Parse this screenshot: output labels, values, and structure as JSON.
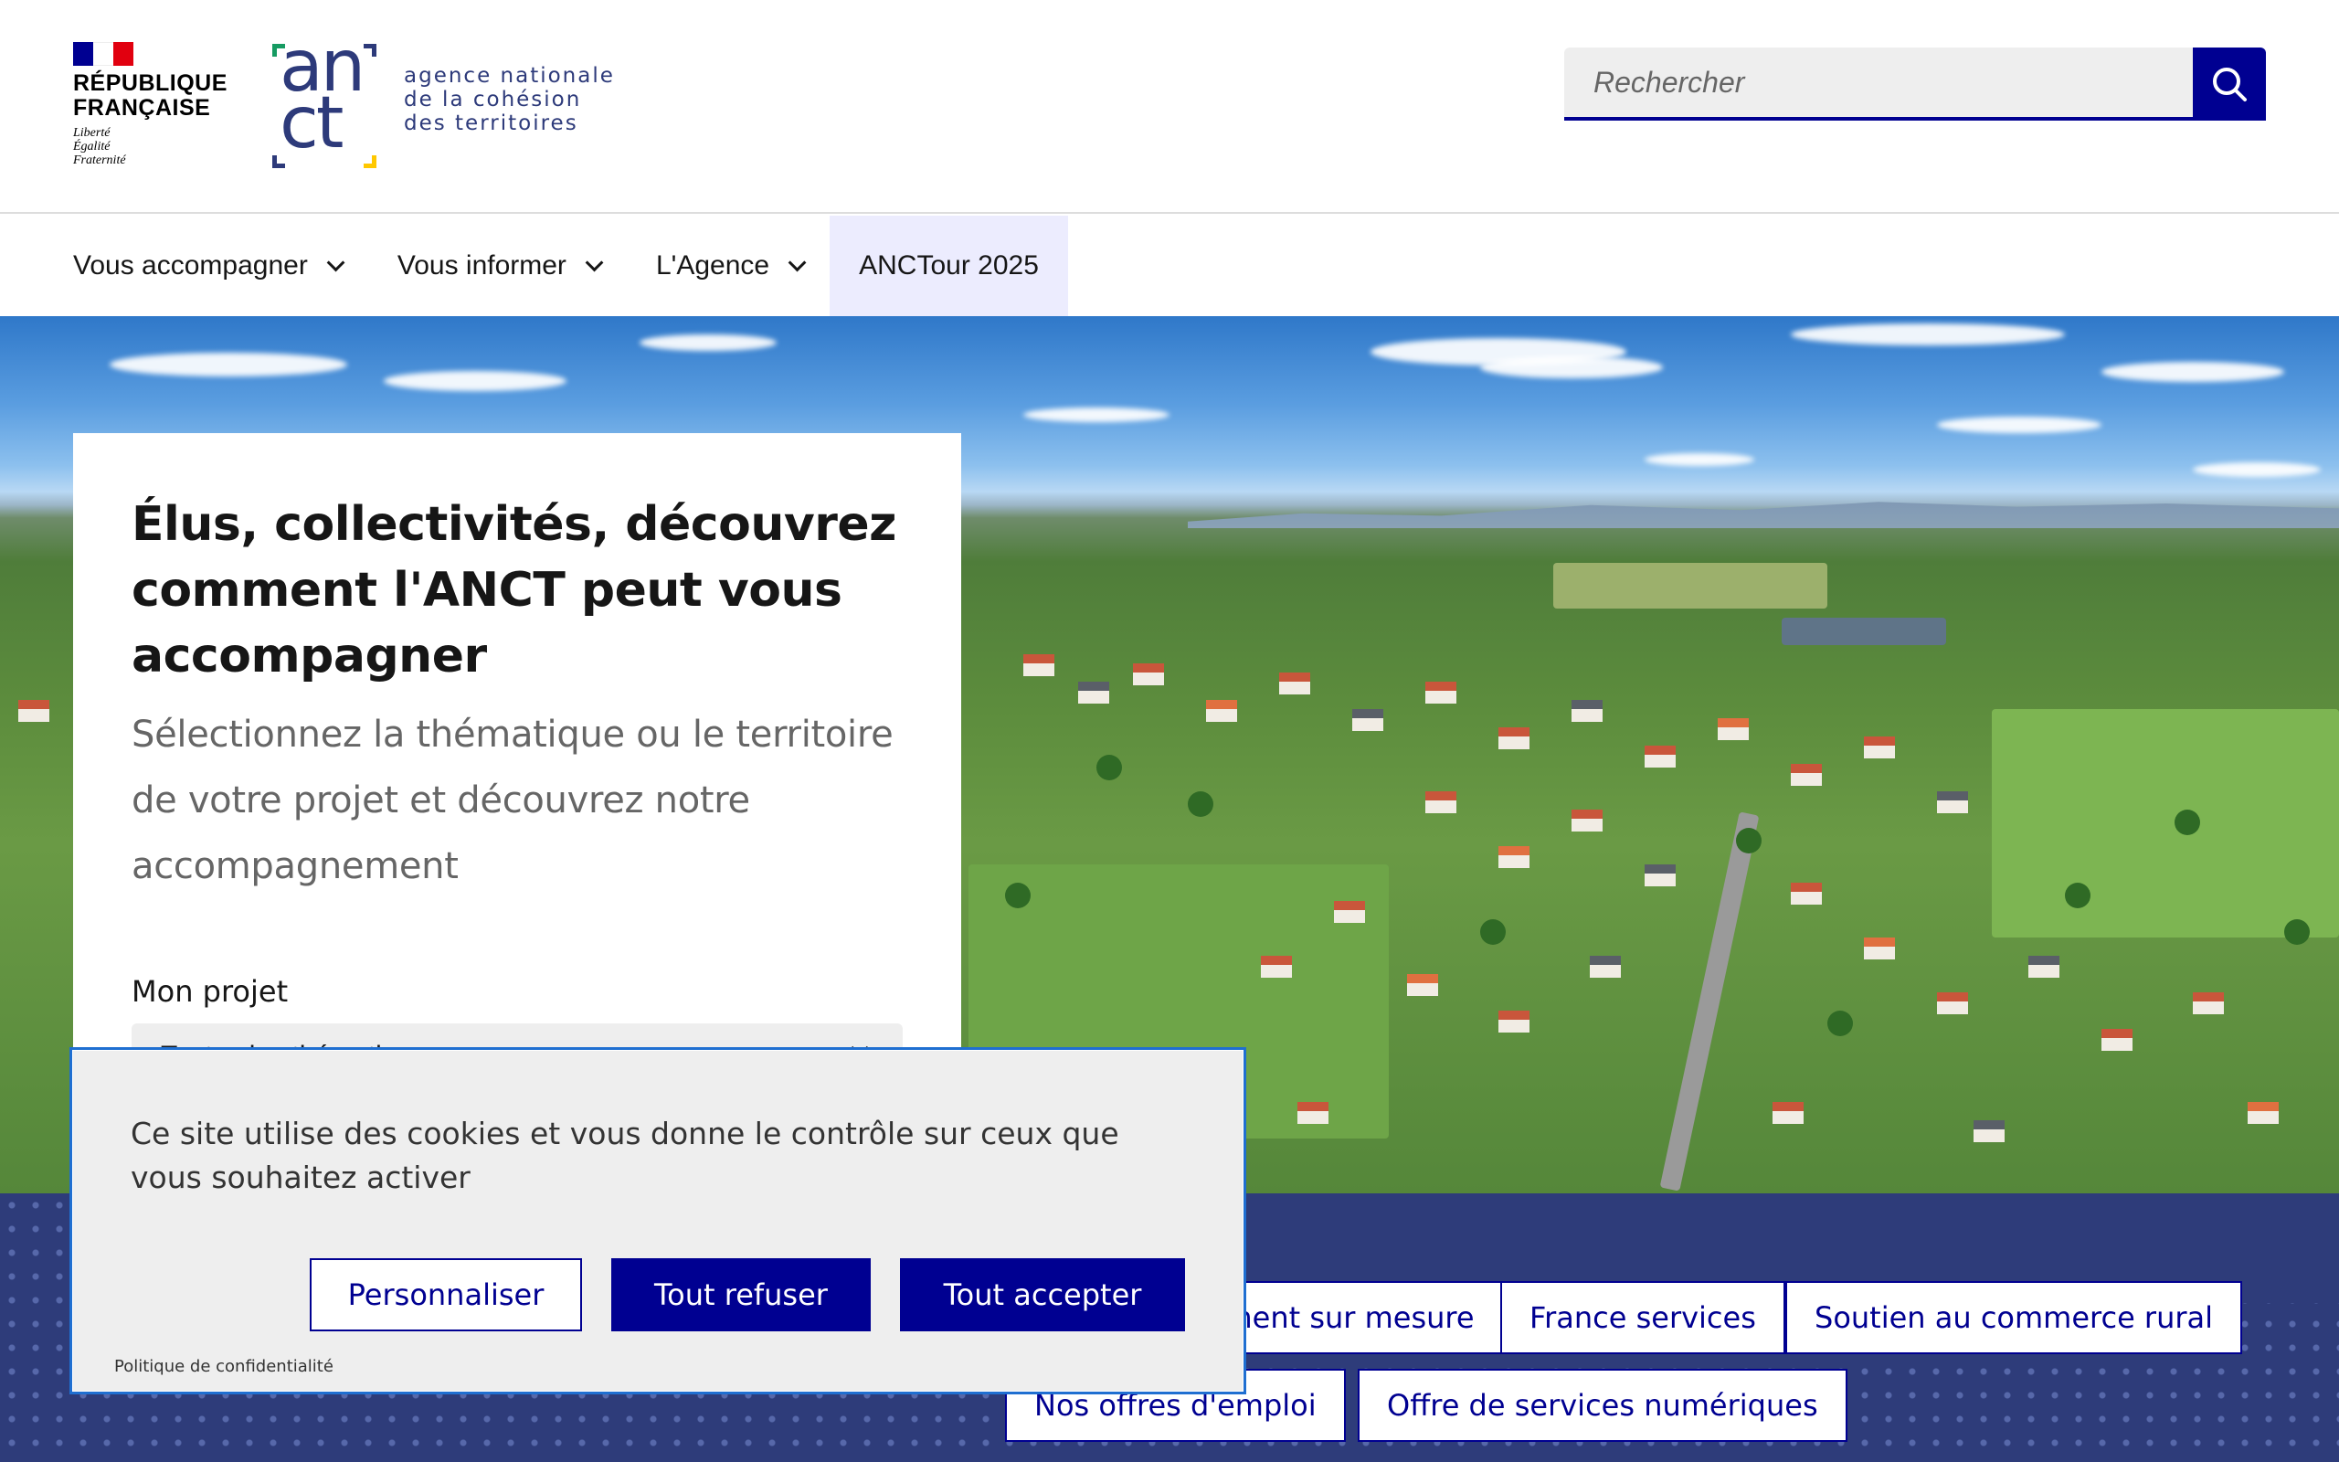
{
  "header": {
    "republique": {
      "name": "RÉPUBLIQUE\nFRANÇAISE",
      "motto": "Liberté\nÉgalité\nFraternité"
    },
    "agency": {
      "mark": "an\nct",
      "name": "agence nationale\nde la cohésion\ndes territoires"
    },
    "search": {
      "placeholder": "Rechercher",
      "button_icon": "search-icon"
    }
  },
  "nav": {
    "items": [
      {
        "label": "Vous accompagner",
        "has_dropdown": true
      },
      {
        "label": "Vous informer",
        "has_dropdown": true
      },
      {
        "label": "L'Agence",
        "has_dropdown": true
      },
      {
        "label": "ANCTour 2025",
        "has_dropdown": false,
        "active": true
      }
    ]
  },
  "hero": {
    "title": "Élus, collectivités, découvrez comment l'ANCT peut vous accompagner",
    "subtitle": "Sélectionnez la thématique ou le territoire de votre projet et découvrez notre accompagnement",
    "project_label": "Mon projet",
    "project_select": "Toutes les thématiques"
  },
  "tags": {
    "row1": [
      "Accompagnement sur mesure",
      "France services",
      "Soutien au commerce rural"
    ],
    "row2": [
      "Nos offres d'emploi",
      "Offre de services numériques"
    ]
  },
  "cookie": {
    "text": "Ce site utilise des cookies et vous donne le contrôle sur ceux que vous souhaitez activer",
    "buttons": {
      "customize": "Personnaliser",
      "refuse": "Tout refuser",
      "accept": "Tout accepter"
    },
    "privacy_link": "Politique de confidentialité"
  },
  "colors": {
    "primary": "#000091",
    "band": "#2e3c7a",
    "nav_active_bg": "#ececfe",
    "focus_outline": "#1f6fd1"
  }
}
